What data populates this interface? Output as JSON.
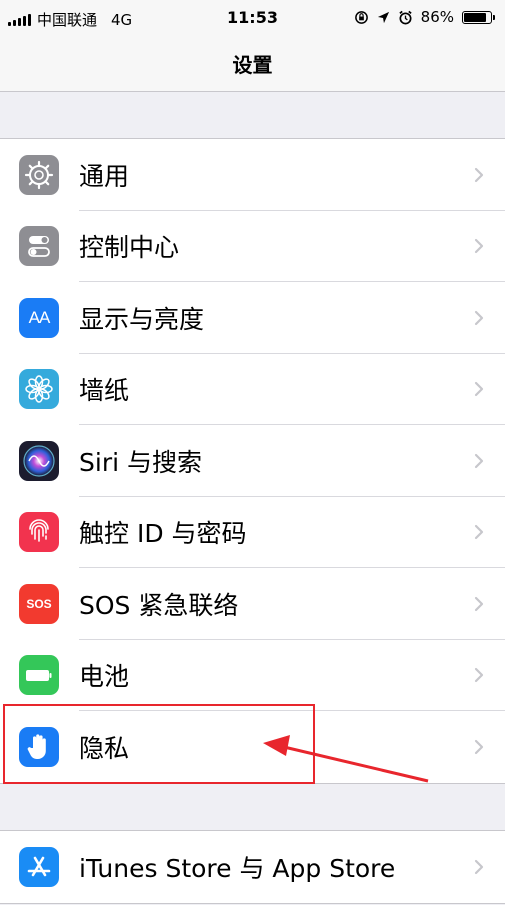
{
  "status_bar": {
    "carrier": "中国联通",
    "network": "4G",
    "time": "11:53",
    "battery_percent": "86%",
    "battery_level": 0.86
  },
  "nav": {
    "title": "设置"
  },
  "settings": [
    {
      "label": "通用",
      "icon": "gear-icon",
      "color": "#8e8e93"
    },
    {
      "label": "控制中心",
      "icon": "toggles-icon",
      "color": "#8e8e93"
    },
    {
      "label": "显示与亮度",
      "icon": "text-size-icon",
      "color": "#1a7cf5",
      "icon_text": "AA"
    },
    {
      "label": "墙纸",
      "icon": "flower-icon",
      "color": "#35aadc"
    },
    {
      "label": "Siri 与搜索",
      "icon": "siri-icon",
      "color": "#1c1c2e"
    },
    {
      "label": "触控 ID 与密码",
      "icon": "fingerprint-icon",
      "color": "#f2334e"
    },
    {
      "label": "SOS 紧急联络",
      "icon": "sos-icon",
      "color": "#f23a2f",
      "icon_text": "SOS"
    },
    {
      "label": "电池",
      "icon": "battery-icon",
      "color": "#34c759"
    },
    {
      "label": "隐私",
      "icon": "hand-icon",
      "color": "#1a7cf5"
    }
  ],
  "store": [
    {
      "label": "iTunes Store 与 App Store",
      "icon": "app-store-icon",
      "color": "#1a8cf5"
    }
  ],
  "annotation_color": "#e8262d"
}
